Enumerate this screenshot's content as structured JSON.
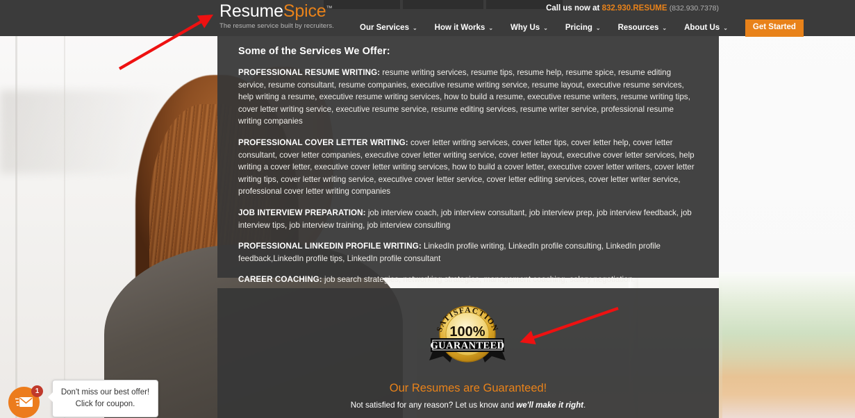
{
  "header": {
    "logo": {
      "part1": "Resume",
      "part2": "Spice",
      "tm": "™",
      "tagline": "The resume service built by recruiters."
    },
    "call": {
      "prefix": "Call us now at",
      "number": "832.930.RESUME",
      "alt": "(832.930.7378)"
    },
    "nav": [
      {
        "label": "Our Services",
        "caret": "⌄"
      },
      {
        "label": "How it Works",
        "caret": "⌄"
      },
      {
        "label": "Why Us",
        "caret": "⌄"
      },
      {
        "label": "Pricing",
        "caret": "⌄"
      },
      {
        "label": "Resources",
        "caret": "⌄"
      },
      {
        "label": "About Us",
        "caret": "⌄"
      }
    ],
    "cta": "Get Started"
  },
  "services_panel": {
    "title": "Some of the Services We Offer:",
    "items": [
      {
        "heading": "PROFESSIONAL RESUME WRITING:",
        "body": " resume writing services, resume tips, resume help, resume spice, resume editing service, resume consultant, resume companies, executive resume writing service, resume layout, executive resume services, help writing a resume, executive resume writing services, how to build a resume, executive resume writers, resume writing tips, cover letter writing service, executive resume service, resume editing services, resume writer service, professional resume writing companies"
      },
      {
        "heading": "PROFESSIONAL COVER LETTER WRITING:",
        "body": " cover letter writing services, cover letter tips, cover letter help, cover letter consultant, cover letter companies, executive cover letter writing service, cover letter layout, executive cover letter services, help writing a cover letter, executive cover letter writing services, how to build a cover letter, executive cover letter writers, cover letter writing tips, cover letter writing service, executive cover letter service, cover letter editing services, cover letter writer service, professional cover letter writing companies"
      },
      {
        "heading": "JOB INTERVIEW PREPARATION:",
        "body": " job interview coach, job interview consultant, job interview prep, job interview feedback, job interview tips, job interview training, job interview consulting"
      },
      {
        "heading": "PROFESSIONAL LINKEDIN PROFILE WRITING:",
        "body": " LinkedIn profile writing, LinkedIn profile consulting, LinkedIn profile feedback,LinkedIn profile tips, LinkedIn profile consultant"
      },
      {
        "heading": "CAREER COACHING:",
        "body": " job search strategies, networking strategies, management coaching, salary negotiation."
      }
    ]
  },
  "guarantee_panel": {
    "badge": {
      "arc_text": "SATISFACTION",
      "percent": "100%",
      "banner": "GUARANTEED"
    },
    "title": "Our Resumes are Guaranteed!",
    "subtitle_pre": "Not satisfied for any reason? Let us know and ",
    "subtitle_em": "we'll make it right",
    "subtitle_post": "."
  },
  "coupon_widget": {
    "badge_count": "1",
    "line1": "Don't miss our best offer!",
    "line2": "Click for coupon."
  },
  "colors": {
    "brand_orange": "#e8821a",
    "header_dark": "#3b3b3b",
    "panel_dark": "rgba(55,55,55,0.94)",
    "annotation_red": "#ee1111",
    "badge_gold": "#e8b422",
    "coupon_orange": "#ec7c1d",
    "notification_red": "#c0392b"
  }
}
